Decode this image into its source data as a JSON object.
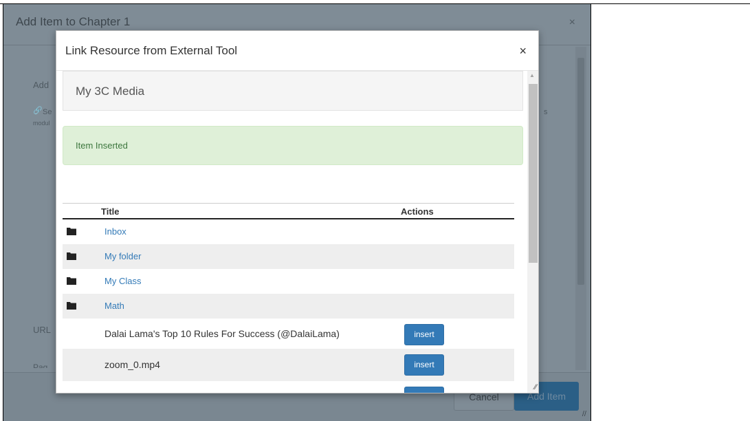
{
  "background_dialog": {
    "title": "Add Item to Chapter 1",
    "close_glyph": "×",
    "fragment_add": "Add",
    "fragment_select": "Se",
    "fragment_s": "s",
    "fragment_module": "modul",
    "fragment_url": "URL",
    "fragment_page": "Pag",
    "cancel_label": "Cancel",
    "add_item_label": "Add Item"
  },
  "modal": {
    "title": "Link Resource from External Tool",
    "close_glyph": "×",
    "resource_name": "My 3C Media",
    "alert_text": "Item Inserted"
  },
  "table": {
    "headers": {
      "title": "Title",
      "actions": "Actions"
    },
    "rows": [
      {
        "icon": "folder-icon",
        "label": "Inbox"
      },
      {
        "icon": "folder-icon",
        "label": "My folder"
      },
      {
        "icon": "folder-icon",
        "label": "My Class"
      },
      {
        "icon": "folder-icon",
        "label": "Math"
      },
      {
        "label": "Dalai Lama's Top 10 Rules For Success (@DalaiLama)",
        "action": "insert"
      },
      {
        "label": "zoom_0.mp4",
        "action": "insert"
      }
    ]
  },
  "colors": {
    "link": "#337ab7",
    "button": "#337ab7",
    "alert_bg": "#dff0d8",
    "alert_text": "#3c763d",
    "overlay": "#7f8c96"
  }
}
